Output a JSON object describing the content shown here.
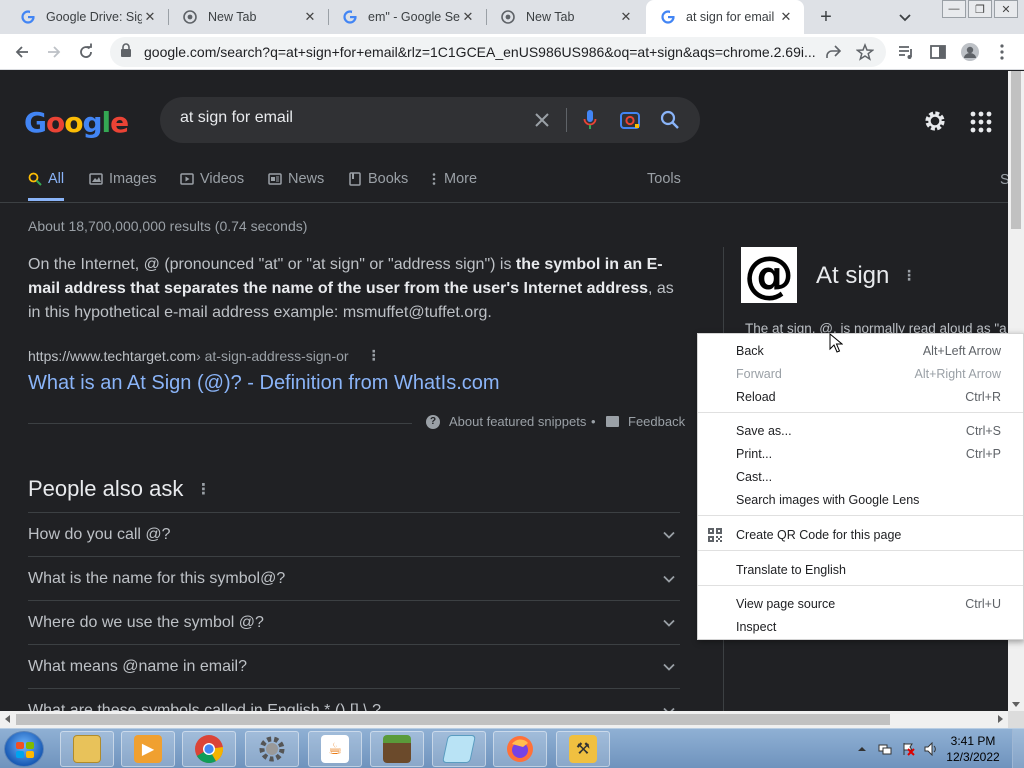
{
  "browser": {
    "tabs": [
      {
        "title": "Google Drive: Sig",
        "favicon": "google-g"
      },
      {
        "title": "New Tab",
        "favicon": "chrome"
      },
      {
        "title": "em\" - Google Sea",
        "favicon": "google-g"
      },
      {
        "title": "New Tab",
        "favicon": "chrome"
      },
      {
        "title": "at sign for email -",
        "favicon": "google-g",
        "active": true
      }
    ],
    "new_tab_symbol": "+",
    "url": "google.com/search?q=at+sign+for+email&rlz=1C1GCEA_enUS986US986&oq=at+sign&aqs=chrome.2.69i..."
  },
  "google": {
    "logo_letters": [
      "G",
      "o",
      "o",
      "g",
      "l",
      "e"
    ],
    "logo_colors": [
      "#4285f4",
      "#ea4335",
      "#fbbc05",
      "#4285f4",
      "#34a853",
      "#ea4335"
    ],
    "search_query": "at sign for email",
    "nav_tabs": [
      "All",
      "Images",
      "Videos",
      "News",
      "Books",
      "More"
    ],
    "tools_label": "Tools",
    "cut_tab_label": "S",
    "result_stats": "About 18,700,000,000 results (0.74 seconds)",
    "snippet": {
      "text_before": "On the Internet, @ (pronounced \"at\" or \"at sign\" or \"address sign\") is ",
      "bold": "the symbol in an E-mail address that separates the name of the user from the user's Internet address",
      "text_after": ", as in this hypothetical e-mail address example: msmuffet@tuffet.org."
    },
    "cite_domain": "https://www.techtarget.com",
    "cite_path": " › at-sign-address-sign-or",
    "result_title": "What is an At Sign (@)? - Definition from WhatIs.com",
    "about_snippets": "About featured snippets",
    "separator_dot": "•",
    "feedback": "Feedback",
    "paa_title": "People also ask",
    "paa_questions": [
      "How do you call @?",
      "What is the name for this symbol@?",
      "Where do we use the symbol @?",
      "What means @name in email?",
      "What are these symbols called in English * () [] \\ ?"
    ],
    "knowledge_panel": {
      "symbol": "@",
      "title": "At sign",
      "description": "The at sign, @, is normally read aloud as \"a"
    }
  },
  "context_menu": {
    "items": [
      {
        "label": "Back",
        "shortcut": "Alt+Left Arrow",
        "disabled": false
      },
      {
        "label": "Forward",
        "shortcut": "Alt+Right Arrow",
        "disabled": true
      },
      {
        "label": "Reload",
        "shortcut": "Ctrl+R",
        "disabled": false
      },
      {
        "label": "Save as...",
        "shortcut": "Ctrl+S",
        "disabled": false
      },
      {
        "label": "Print...",
        "shortcut": "Ctrl+P",
        "disabled": false
      },
      {
        "label": "Cast...",
        "shortcut": "",
        "disabled": false
      },
      {
        "label": "Search images with Google Lens",
        "shortcut": "",
        "disabled": false
      },
      {
        "label": "Create QR Code for this page",
        "shortcut": "",
        "disabled": false
      },
      {
        "label": "Translate to English",
        "shortcut": "",
        "disabled": false
      },
      {
        "label": "View page source",
        "shortcut": "Ctrl+U",
        "disabled": false
      },
      {
        "label": "Inspect",
        "shortcut": "",
        "disabled": false
      }
    ]
  },
  "taskbar": {
    "apps": [
      "file-explorer",
      "media-player",
      "chrome",
      "settings-gear",
      "java",
      "minecraft",
      "notepad",
      "firefox",
      "tools"
    ],
    "time": "3:41 PM",
    "date": "12/3/2022"
  },
  "colors": {
    "page_bg": "#202124",
    "link": "#8ab4f8",
    "accent_blue": "#4285f4"
  }
}
